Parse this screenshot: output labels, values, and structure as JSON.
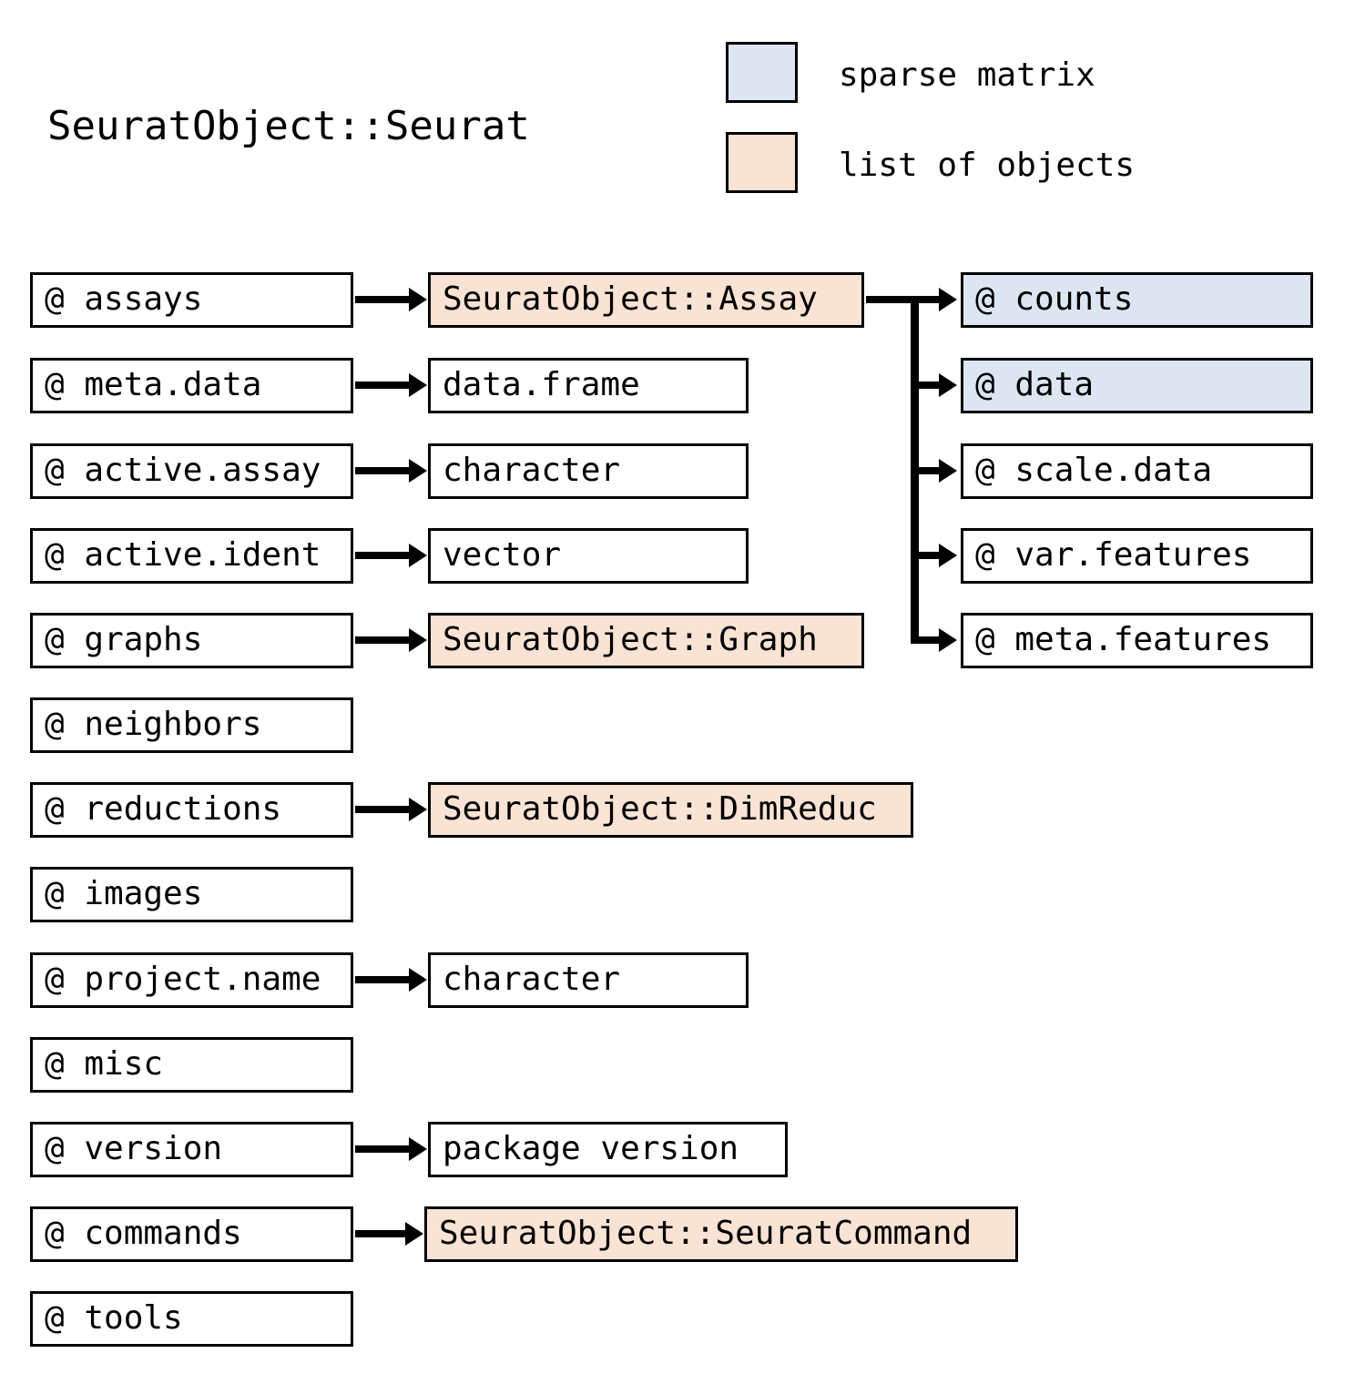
{
  "title": "SeuratObject::Seurat",
  "legend": {
    "items": [
      {
        "label": "sparse matrix",
        "color": "#dce6f2",
        "kind": "sparse"
      },
      {
        "label": "list of objects",
        "color": "#f9e3d4",
        "kind": "listobj"
      }
    ]
  },
  "colors": {
    "sparse_matrix": "#dce6f2",
    "list_of_objects": "#f9e3d4",
    "border": "#000000",
    "background": "#ffffff"
  },
  "columns": {
    "slots": [
      {
        "label": "@ assays",
        "type": "plain",
        "has_arrow": true
      },
      {
        "label": "@ meta.data",
        "type": "plain",
        "has_arrow": true
      },
      {
        "label": "@ active.assay",
        "type": "plain",
        "has_arrow": true
      },
      {
        "label": "@ active.ident",
        "type": "plain",
        "has_arrow": true
      },
      {
        "label": "@ graphs",
        "type": "plain",
        "has_arrow": true
      },
      {
        "label": "@ neighbors",
        "type": "plain",
        "has_arrow": false
      },
      {
        "label": "@ reductions",
        "type": "plain",
        "has_arrow": true
      },
      {
        "label": "@ images",
        "type": "plain",
        "has_arrow": false
      },
      {
        "label": "@ project.name",
        "type": "plain",
        "has_arrow": true
      },
      {
        "label": "@ misc",
        "type": "plain",
        "has_arrow": false
      },
      {
        "label": "@ version",
        "type": "plain",
        "has_arrow": true
      },
      {
        "label": "@ commands",
        "type": "plain",
        "has_arrow": true
      },
      {
        "label": "@ tools",
        "type": "plain",
        "has_arrow": false
      }
    ],
    "types": [
      {
        "label": "SeuratObject::Assay",
        "type": "listobj"
      },
      {
        "label": "data.frame",
        "type": "plain"
      },
      {
        "label": "character",
        "type": "plain"
      },
      {
        "label": "vector",
        "type": "plain"
      },
      {
        "label": "SeuratObject::Graph",
        "type": "listobj"
      },
      {
        "label": "SeuratObject::DimReduc",
        "type": "listobj"
      },
      {
        "label": "character",
        "type": "plain"
      },
      {
        "label": "package version",
        "type": "plain"
      },
      {
        "label": "SeuratObject::SeuratCommand",
        "type": "listobj"
      }
    ],
    "assay_slots": [
      {
        "label": "@ counts",
        "type": "sparse"
      },
      {
        "label": "@ data",
        "type": "sparse"
      },
      {
        "label": "@ scale.data",
        "type": "plain"
      },
      {
        "label": "@ var.features",
        "type": "plain"
      },
      {
        "label": "@ meta.features",
        "type": "plain"
      }
    ]
  }
}
